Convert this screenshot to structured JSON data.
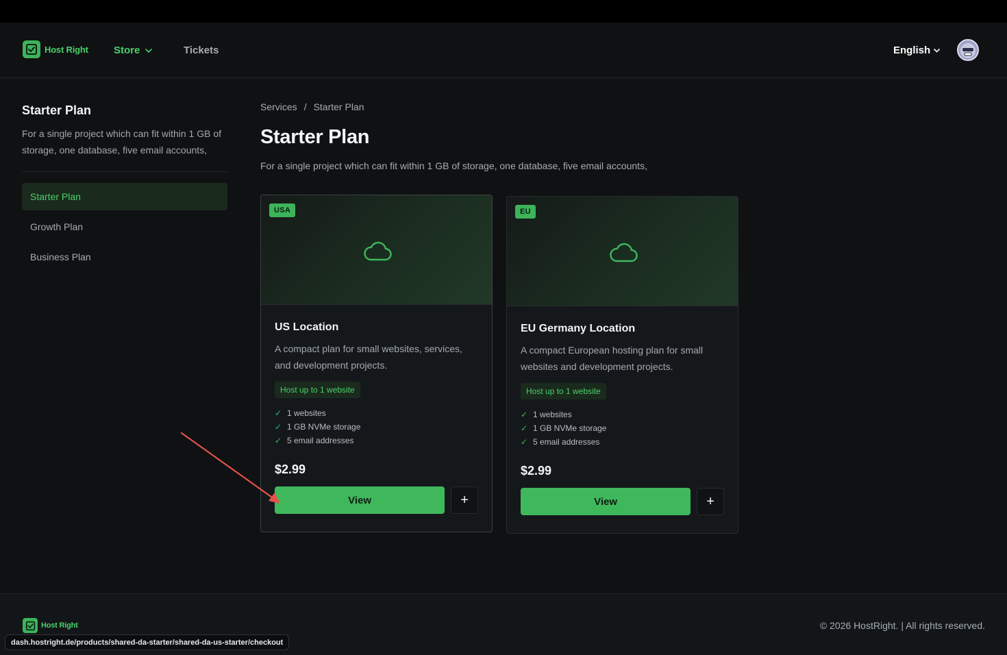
{
  "app": {
    "brand": "Host Right"
  },
  "nav": {
    "store_label": "Store",
    "tickets_label": "Tickets",
    "language": "English"
  },
  "sidebar": {
    "title": "Starter Plan",
    "description": "For a single project which can fit within 1 GB of storage, one database, five email accounts,",
    "items": [
      {
        "label": "Starter Plan",
        "active": true
      },
      {
        "label": "Growth Plan",
        "active": false
      },
      {
        "label": "Business Plan",
        "active": false
      }
    ]
  },
  "breadcrumb": {
    "parent": "Services",
    "separator": "/",
    "current": "Starter Plan"
  },
  "main": {
    "title": "Starter Plan",
    "description": "For a single project which can fit within 1 GB of storage, one database, five email accounts,"
  },
  "cards": [
    {
      "region": "USA",
      "title": "US Location",
      "description": "A compact plan for small websites, services, and development projects.",
      "badge": "Host up to 1 website",
      "features": [
        "1 websites",
        "1 GB NVMe storage",
        "5 email addresses"
      ],
      "price": "$2.99",
      "view_label": "View",
      "add_label": "+"
    },
    {
      "region": "EU",
      "title": "EU Germany Location",
      "description": "A compact European hosting plan for small websites and development projects.",
      "badge": "Host up to 1 website",
      "features": [
        "1 websites",
        "1 GB NVMe storage",
        "5 email addresses"
      ],
      "price": "$2.99",
      "view_label": "View",
      "add_label": "+"
    }
  ],
  "footer": {
    "brand": "Host Right",
    "copyright": "© 2026 HostRight. | All rights reserved."
  },
  "status_url": "dash.hostright.de/products/shared-da-starter/shared-da-us-starter/checkout",
  "colors": {
    "accent": "#3fb85c",
    "accent_text": "#4bd06a",
    "annotation_arrow": "#e5534b"
  }
}
